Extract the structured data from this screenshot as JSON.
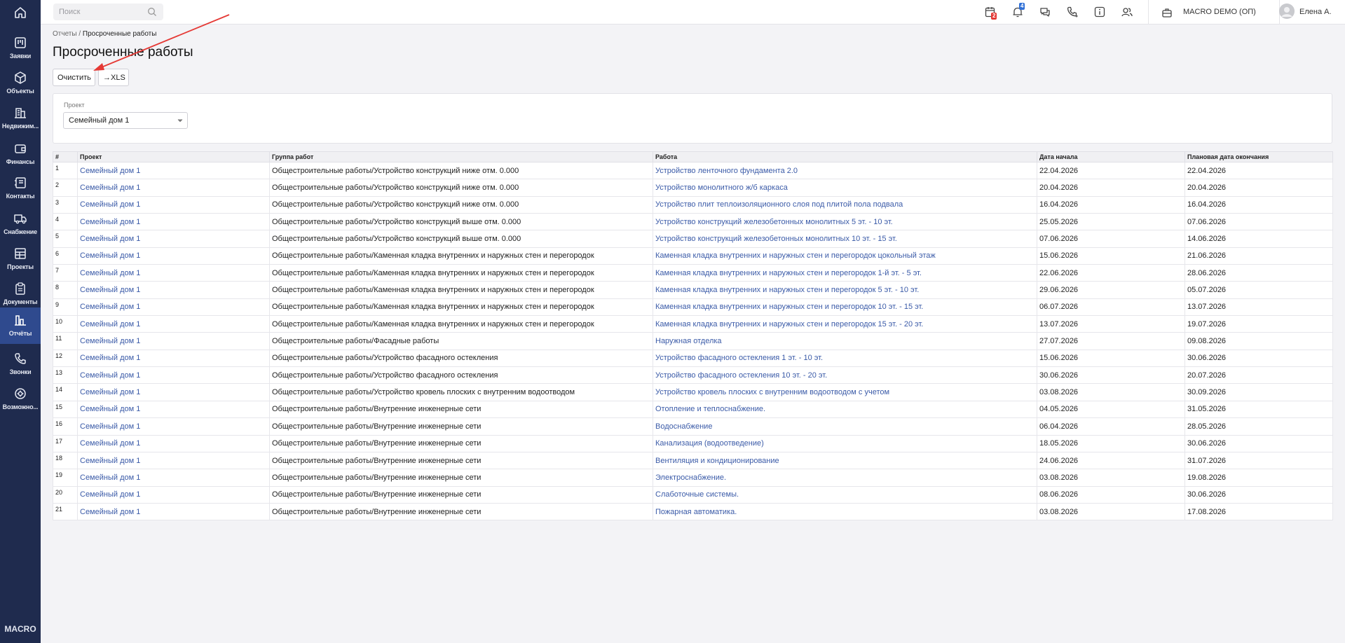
{
  "sidebar": {
    "brand": "MACRO",
    "items": [
      {
        "label": "",
        "icon": "home-icon"
      },
      {
        "label": "Заявки",
        "icon": "kanban-icon"
      },
      {
        "label": "Объекты",
        "icon": "cube-icon"
      },
      {
        "label": "Недвижим...",
        "icon": "buildings-icon"
      },
      {
        "label": "Финансы",
        "icon": "wallet-icon"
      },
      {
        "label": "Контакты",
        "icon": "contacts-icon"
      },
      {
        "label": "Снабжение",
        "icon": "truck-icon"
      },
      {
        "label": "Проекты",
        "icon": "project-icon"
      },
      {
        "label": "Документы",
        "icon": "clipboard-icon"
      },
      {
        "label": "Отчёты",
        "icon": "bar-chart-icon"
      },
      {
        "label": "Звонки",
        "icon": "phone-icon"
      },
      {
        "label": "Возможно...",
        "icon": "settings-icon"
      }
    ]
  },
  "header": {
    "search_placeholder": "Поиск",
    "calendar_badge": "2",
    "notifications_badge": "4",
    "company": "MACRO DEMO (ОП)",
    "user": "Елена А."
  },
  "breadcrumb": {
    "parent": "Отчеты",
    "separator": "/",
    "current": "Просроченные работы"
  },
  "page_title": "Просроченные работы",
  "toolbar": {
    "clear_label": "Очистить",
    "export_label": "→XLS"
  },
  "filter": {
    "label": "Проект",
    "value": "Семейный дом 1"
  },
  "table": {
    "columns": [
      "#",
      "Проект",
      "Группа работ",
      "Работа",
      "Дата начала",
      "Плановая дата окончания"
    ],
    "rows": [
      {
        "n": "1",
        "project": "Семейный дом 1",
        "group": "Общестроительные работы/Устройство конструкций ниже отм. 0.000",
        "work": "Устройство ленточного фундамента 2.0",
        "start": "22.04.2026",
        "end": "22.04.2026"
      },
      {
        "n": "2",
        "project": "Семейный дом 1",
        "group": "Общестроительные работы/Устройство конструкций ниже отм. 0.000",
        "work": "Устройство монолитного ж/б каркаса",
        "start": "20.04.2026",
        "end": "20.04.2026"
      },
      {
        "n": "3",
        "project": "Семейный дом 1",
        "group": "Общестроительные работы/Устройство конструкций ниже отм. 0.000",
        "work": "Устройство плит теплоизоляционного слоя под плитой пола подвала",
        "start": "16.04.2026",
        "end": "16.04.2026"
      },
      {
        "n": "4",
        "project": "Семейный дом 1",
        "group": "Общестроительные работы/Устройство конструкций выше отм. 0.000",
        "work": "Устройство конструкций железобетонных монолитных 5 эт. - 10 эт.",
        "start": "25.05.2026",
        "end": "07.06.2026"
      },
      {
        "n": "5",
        "project": "Семейный дом 1",
        "group": "Общестроительные работы/Устройство конструкций выше отм. 0.000",
        "work": "Устройство конструкций железобетонных монолитных 10 эт. - 15 эт.",
        "start": "07.06.2026",
        "end": "14.06.2026"
      },
      {
        "n": "6",
        "project": "Семейный дом 1",
        "group": "Общестроительные работы/Каменная кладка внутренних и наружных стен и перегородок",
        "work": "Каменная кладка внутренних и наружных стен и перегородок цокольный этаж",
        "start": "15.06.2026",
        "end": "21.06.2026"
      },
      {
        "n": "7",
        "project": "Семейный дом 1",
        "group": "Общестроительные работы/Каменная кладка внутренних и наружных стен и перегородок",
        "work": "Каменная кладка внутренних и наружных стен и перегородок 1-й эт. - 5 эт.",
        "start": "22.06.2026",
        "end": "28.06.2026"
      },
      {
        "n": "8",
        "project": "Семейный дом 1",
        "group": "Общестроительные работы/Каменная кладка внутренних и наружных стен и перегородок",
        "work": "Каменная кладка внутренних и наружных стен и перегородок  5 эт. - 10 эт.",
        "start": "29.06.2026",
        "end": "05.07.2026"
      },
      {
        "n": "9",
        "project": "Семейный дом 1",
        "group": "Общестроительные работы/Каменная кладка внутренних и наружных стен и перегородок",
        "work": "Каменная кладка внутренних и наружных стен и перегородок  10 эт. - 15 эт.",
        "start": "06.07.2026",
        "end": "13.07.2026"
      },
      {
        "n": "10",
        "project": "Семейный дом 1",
        "group": "Общестроительные работы/Каменная кладка внутренних и наружных стен и перегородок",
        "work": "Каменная кладка внутренних и наружных стен и перегородок  15 эт. - 20 эт.",
        "start": "13.07.2026",
        "end": "19.07.2026"
      },
      {
        "n": "11",
        "project": "Семейный дом 1",
        "group": "Общестроительные работы/Фасадные работы",
        "work": "Наружная отделка",
        "start": "27.07.2026",
        "end": "09.08.2026"
      },
      {
        "n": "12",
        "project": "Семейный дом 1",
        "group": "Общестроительные работы/Устройство фасадного остекления",
        "work": "Устройство фасадного остекления 1 эт. - 10 эт.",
        "start": "15.06.2026",
        "end": "30.06.2026"
      },
      {
        "n": "13",
        "project": "Семейный дом 1",
        "group": "Общестроительные работы/Устройство фасадного остекления",
        "work": "Устройство фасадного остекления 10 эт. - 20 эт.",
        "start": "30.06.2026",
        "end": "20.07.2026"
      },
      {
        "n": "14",
        "project": "Семейный дом 1",
        "group": "Общестроительные работы/Устройство кровель плоских с внутренним водоотводом",
        "work": "Устройство кровель плоских с внутренним водоотводом с учетом",
        "start": "03.08.2026",
        "end": "30.09.2026"
      },
      {
        "n": "15",
        "project": "Семейный дом 1",
        "group": "Общестроительные работы/Внутренние инженерные сети",
        "work": "Отопление и теплоснабжение.",
        "start": "04.05.2026",
        "end": "31.05.2026"
      },
      {
        "n": "16",
        "project": "Семейный дом 1",
        "group": "Общестроительные работы/Внутренние инженерные сети",
        "work": "Водоснабжение",
        "start": "06.04.2026",
        "end": "28.05.2026"
      },
      {
        "n": "17",
        "project": "Семейный дом 1",
        "group": "Общестроительные работы/Внутренние инженерные сети",
        "work": "Канализация (водоотведение)",
        "start": "18.05.2026",
        "end": "30.06.2026"
      },
      {
        "n": "18",
        "project": "Семейный дом 1",
        "group": "Общестроительные работы/Внутренние инженерные сети",
        "work": "Вентиляция и кондиционирование",
        "start": "24.06.2026",
        "end": "31.07.2026"
      },
      {
        "n": "19",
        "project": "Семейный дом 1",
        "group": "Общестроительные работы/Внутренние инженерные сети",
        "work": "Электроснабжение.",
        "start": "03.08.2026",
        "end": "19.08.2026"
      },
      {
        "n": "20",
        "project": "Семейный дом 1",
        "group": "Общестроительные работы/Внутренние инженерные сети",
        "work": "Слаботочные системы.",
        "start": "08.06.2026",
        "end": "30.06.2026"
      },
      {
        "n": "21",
        "project": "Семейный дом 1",
        "group": "Общестроительные работы/Внутренние инженерные сети",
        "work": "Пожарная автоматика.",
        "start": "03.08.2026",
        "end": "17.08.2026"
      }
    ]
  },
  "colors": {
    "sidebar": "#1f2b4e",
    "active_nav": "#2f4a8e",
    "link": "#3b5ba8",
    "badge_red": "#e53935",
    "badge_blue": "#2f6fd6",
    "annotation_arrow": "#e53935"
  }
}
